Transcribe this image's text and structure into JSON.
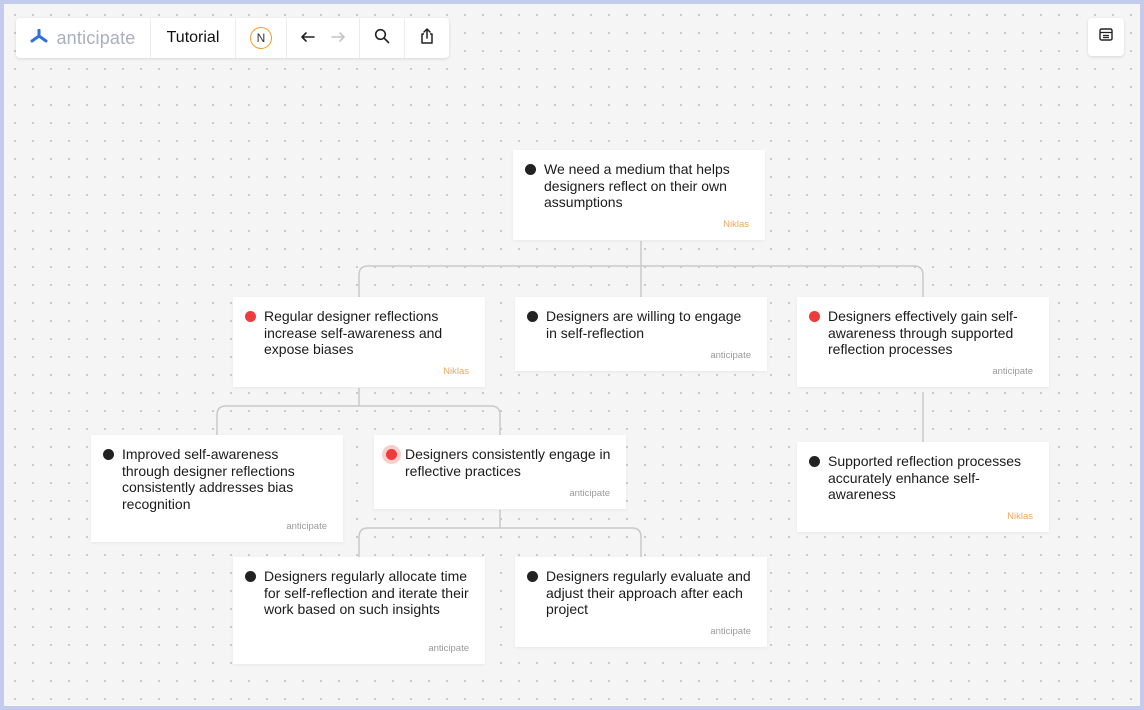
{
  "toolbar": {
    "brand": "anticipate",
    "document_title": "Tutorial",
    "avatar_initial": "N",
    "icons": [
      "logo-icon",
      "undo-icon",
      "redo-icon",
      "search-icon",
      "share-icon"
    ]
  },
  "sidebar_toggle_icon": "panel-icon",
  "colors": {
    "brand_blue": "#2f6fe0",
    "red_marker": "#ef3b3b",
    "dark_marker": "#222222",
    "niklas_author": "#f2a65a",
    "anticipate_author": "#9a9a9a",
    "avatar_ring": "#f39a2f"
  },
  "cards": [
    {
      "id": "root",
      "text": "We need a medium that helps designers reflect on their own assumptions",
      "author": "Niklas",
      "marker": "dark"
    },
    {
      "id": "reflections",
      "text": "Regular designer reflections increase self-awareness and expose biases",
      "author": "Niklas",
      "marker": "red"
    },
    {
      "id": "willing",
      "text": "Designers are willing to engage in self-reflection",
      "author": "anticipate",
      "marker": "dark"
    },
    {
      "id": "effectively",
      "text": "Designers effectively gain self-awareness through supported reflection processes",
      "author": "anticipate",
      "marker": "red"
    },
    {
      "id": "improved",
      "text": "Improved self-awareness through designer reflections consistently addresses bias recognition",
      "author": "anticipate",
      "marker": "dark"
    },
    {
      "id": "consistently",
      "text": "Designers consistently engage in reflective practices",
      "author": "anticipate",
      "marker": "red-highlighted"
    },
    {
      "id": "supported",
      "text": "Supported reflection processes accurately enhance self-awareness",
      "author": "Niklas",
      "marker": "dark"
    },
    {
      "id": "allocate",
      "text": "Designers regularly allocate time for self-reflection and iterate their work based on such insights",
      "author": "anticipate",
      "marker": "dark"
    },
    {
      "id": "evaluate",
      "text": "Designers regularly evaluate and adjust their approach after each project",
      "author": "anticipate",
      "marker": "dark"
    }
  ]
}
